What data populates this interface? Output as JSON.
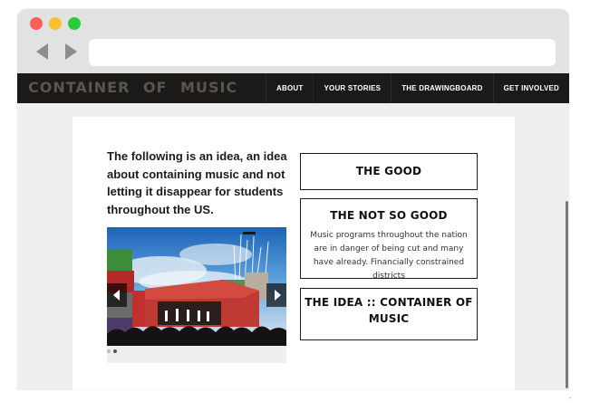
{
  "browser": {
    "controls": [
      "close",
      "minimize",
      "maximize"
    ],
    "back_icon": "chevron-left-icon",
    "forward_icon": "chevron-right-icon",
    "url": ""
  },
  "site": {
    "logo": "CONTAINER OF MUSIC",
    "nav": [
      "ABOUT",
      "YOUR STORIES",
      "THE DRAWINGBOARD",
      "GET INVOLVED"
    ]
  },
  "main": {
    "intro": "The following is an idea, an idea about containing music and not letting it disappear for students throughout the US.",
    "slider": {
      "image": "illustration of a stage built from shipping containers with performers and a crowd under fireworks",
      "prev_icon": "chevron-left-icon",
      "next_icon": "chevron-right-icon",
      "pages": 2,
      "active_page": 2
    },
    "boxes": {
      "good": {
        "heading": "THE GOOD"
      },
      "not_good": {
        "heading": "THE NOT SO GOOD",
        "body": "Music programs throughout the nation are in danger of being cut and many have already. Financially constrained districts"
      },
      "idea": {
        "heading": "THE IDEA :: CONTAINER OF MUSIC"
      }
    }
  },
  "colors": {
    "nav_background": "#1c1a18",
    "logo_text": "#58564f",
    "page_background": "#f0efed",
    "content_background": "#ffffff",
    "box_border": "#1b1b1b"
  }
}
